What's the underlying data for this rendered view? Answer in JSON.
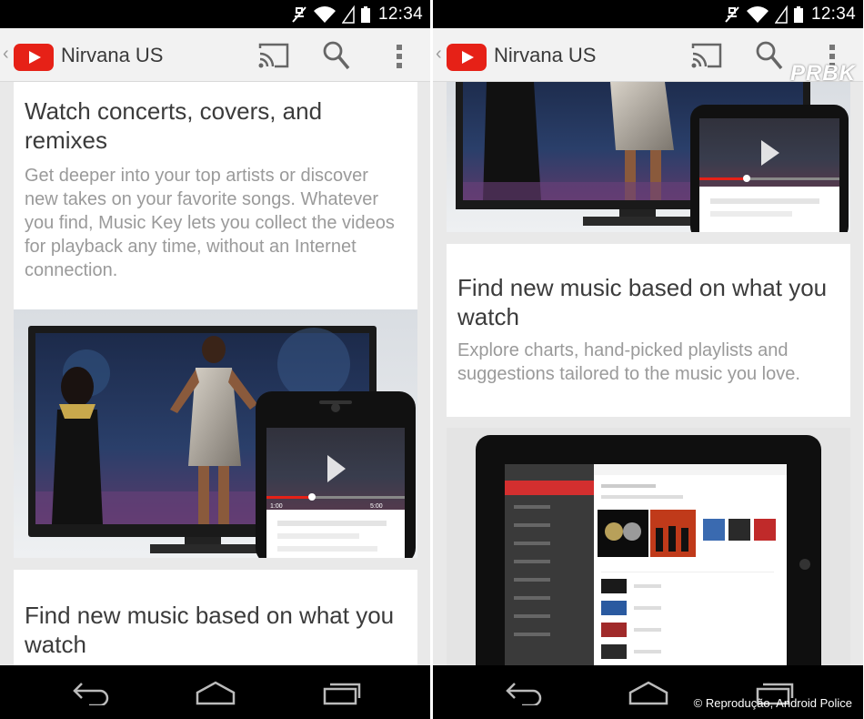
{
  "status_bar": {
    "time": "12:34"
  },
  "app_bar": {
    "title": "Nirvana US"
  },
  "brand": {
    "youtube_red": "#e62117",
    "accent_red": "#d32f2f"
  },
  "left": {
    "card1": {
      "title": "Watch concerts, covers, and remixes",
      "body": "Get deeper into your top artists or discover new takes on your favorite songs. Whatever you find, Music Key lets you collect the videos for playback any time, without an Internet connection."
    },
    "card2": {
      "title": "Find new music based on what you watch"
    }
  },
  "right": {
    "card1": {
      "title": "Find new music based on what you watch",
      "body": "Explore charts, hand-picked playlists and suggestions tailored to the music you love."
    }
  },
  "player": {
    "time_start": "1:00",
    "time_end": "5:00"
  },
  "watermarks": {
    "prbk": "PRBK",
    "credit": "© Reprodução, Android Police"
  },
  "icons": [
    "youtube-logo-icon",
    "cast-icon",
    "search-icon",
    "more-vert-icon",
    "back-icon",
    "home-icon",
    "recents-icon",
    "wifi-icon",
    "signal-icon",
    "battery-icon",
    "muted-icon"
  ]
}
